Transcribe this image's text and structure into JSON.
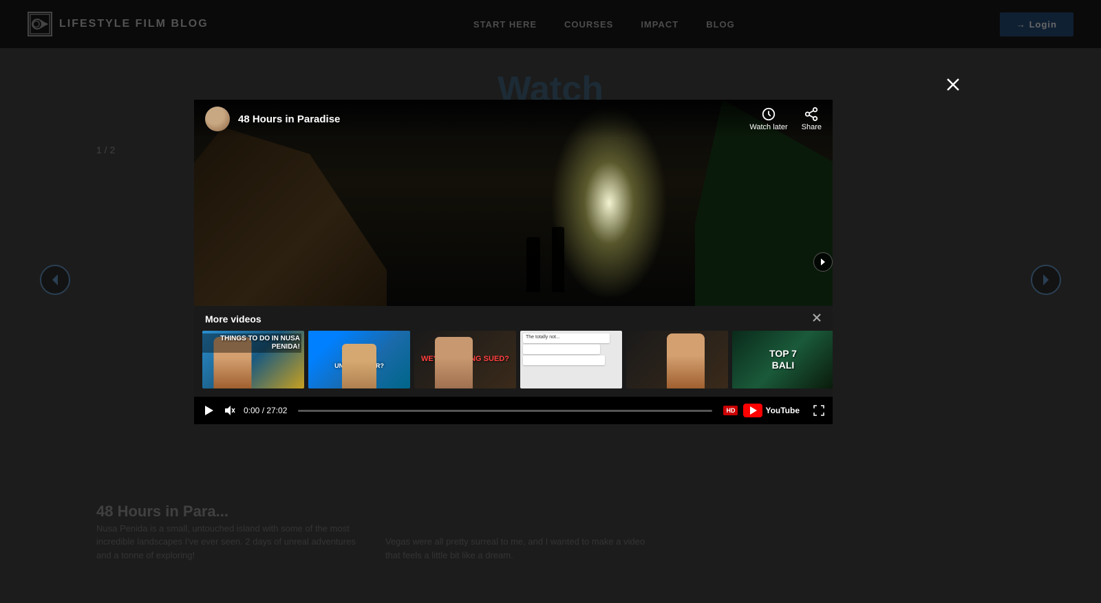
{
  "site": {
    "logo_text": "LIFESTYLE FILM BLOG",
    "nav": {
      "items": [
        {
          "id": "start-here",
          "label": "START HERE"
        },
        {
          "id": "courses",
          "label": "COURSES"
        },
        {
          "id": "impact",
          "label": "IMPACT"
        },
        {
          "id": "blog",
          "label": "BLOG"
        }
      ]
    },
    "login_label": "→ Login"
  },
  "page": {
    "watch_title": "Watch",
    "slide_counter": "1 / 2",
    "card_title": "48 Hours in Para...",
    "card_desc": "Nusa Penida is a small, untouched island with some of the most incredible landscapes I've ever seen. 2 days of unreal adventures and a tonne of exploring!",
    "card_desc2": "Vegas were all pretty surreal to me, and I wanted to make a video that feels a little bit like a dream."
  },
  "modal": {
    "close_icon": "×",
    "video": {
      "channel_name": "48 Hours in Paradise",
      "title": "48 Hours in Paradise",
      "watch_later_label": "Watch later",
      "share_label": "Share",
      "time_current": "0:00",
      "time_total": "27:02",
      "time_display": "0:00 / 27:02"
    },
    "more_videos": {
      "title": "More videos",
      "close_icon": "×",
      "thumbnails": [
        {
          "id": 1,
          "text": "Things To Do In Nusa Penida!",
          "style": "thumb-1"
        },
        {
          "id": 2,
          "text": "$15,000 UNDER WATER?",
          "style": "thumb-2",
          "color": "yellow"
        },
        {
          "id": 3,
          "text": "WE'RE GETTING SUED?",
          "style": "thumb-3",
          "color": "red"
        },
        {
          "id": 4,
          "text": "",
          "style": "thumb-4"
        },
        {
          "id": 5,
          "text": "",
          "style": "thumb-5"
        },
        {
          "id": 6,
          "text": "TOP 7 BALI",
          "style": "thumb-6"
        }
      ]
    }
  }
}
